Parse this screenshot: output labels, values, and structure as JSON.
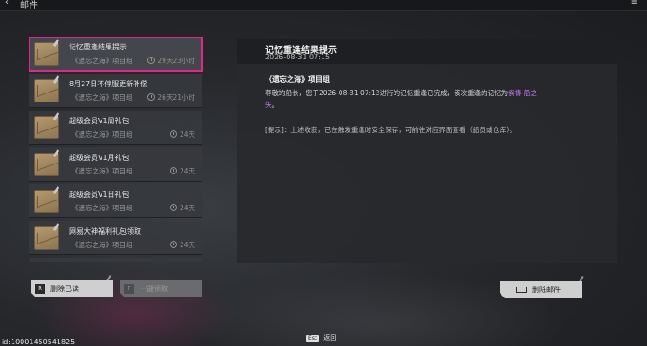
{
  "header": {
    "title": "邮件",
    "back_glyph": "‹",
    "menu_glyph": "≡"
  },
  "mails": [
    {
      "subject": "记忆重逢结果提示",
      "sender": "《遗忘之海》项目组",
      "time": "29天23小时",
      "selected": true
    },
    {
      "subject": "8月27日不停服更新补偿",
      "sender": "《遗忘之海》项目组",
      "time": "26天21小时"
    },
    {
      "subject": "超级会员V1周礼包",
      "sender": "《遗忘之海》项目组",
      "time": "24天"
    },
    {
      "subject": "超级会员V1月礼包",
      "sender": "《遗忘之海》项目组",
      "time": "24天"
    },
    {
      "subject": "超级会员V1日礼包",
      "sender": "《遗忘之海》项目组",
      "time": "24天"
    },
    {
      "subject": "网易大神福利礼包领取",
      "sender": "《遗忘之海》项目组",
      "time": "24天"
    }
  ],
  "buttons": {
    "delete_read": {
      "key": "R",
      "label": "删除已读"
    },
    "claim_all": {
      "key": "F",
      "label": "一键领取"
    },
    "delete_mail": {
      "label": "删除邮件"
    }
  },
  "detail": {
    "title": "记忆重逢结果提示",
    "date": "2026-08-31 07:15",
    "sender": "《遗忘之海》项目组",
    "body_prefix": "尊敬的船长，您于2026-08-31 07:12进行的记忆重逢已完成，该次重逢的记忆为",
    "body_highlight": "紫祷-船之",
    "body_highlight_2": "矢",
    "body_suffix": "。",
    "tip": "[提示]：上述收获，已在触发重逢时安全保存，可前往对应界面查看（船员或仓库）。"
  },
  "footer": {
    "uid": "id:10001450541825",
    "esc_key": "Esc",
    "esc_label": "返回"
  },
  "colors": {
    "selected_border": "#e0278a",
    "highlight": "#c77bf5"
  }
}
